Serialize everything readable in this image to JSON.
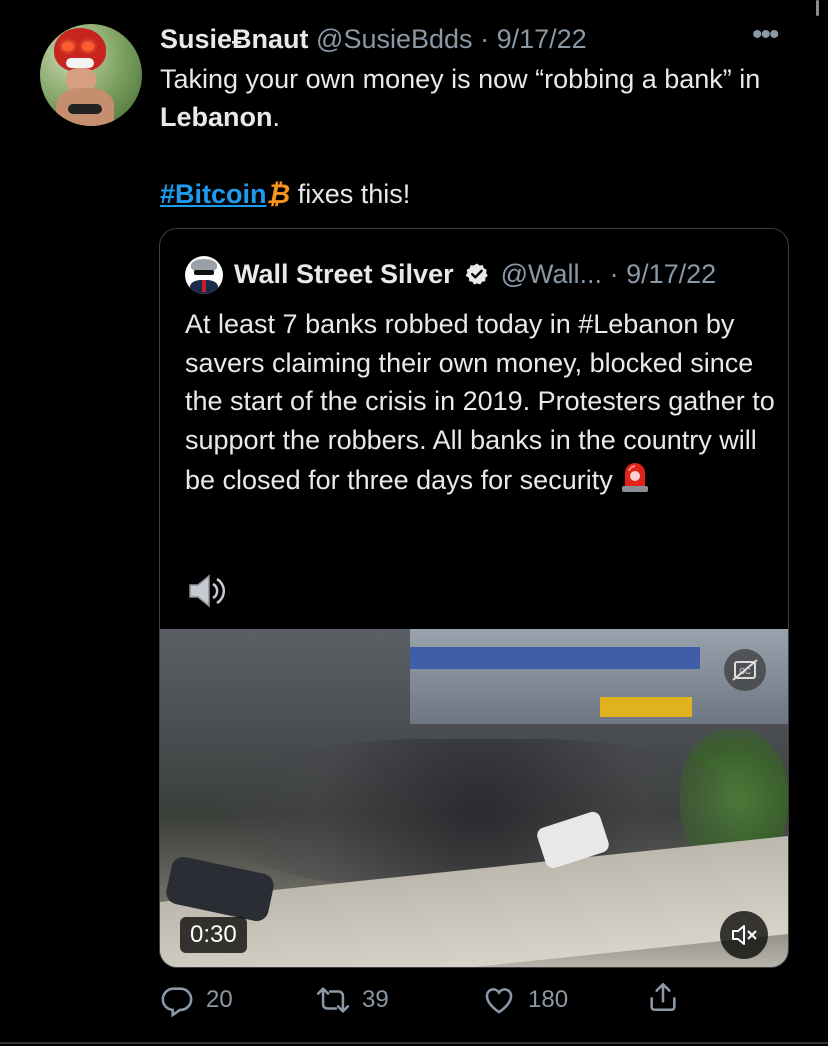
{
  "tweet": {
    "author_name": "SusieɃnaut",
    "author_handle": "@SusieBdds",
    "separator": "·",
    "date": "9/17/22",
    "more": "•••",
    "text_part1": "Taking your own money is now “robbing a bank” in ",
    "text_bold": "Lebanon",
    "text_part2": ".",
    "hashtag": "#Bitcoin",
    "btc_symbol": "₿",
    "text_end": " fixes this!"
  },
  "quote": {
    "author_name": "Wall Street Silver",
    "author_handle": "@Wall...",
    "separator": "·",
    "date": "9/17/22",
    "text": "At least 7 banks robbed today in #Lebanon by savers claiming their own money, blocked since the start of the crisis in 2019. Protesters gather to support the robbers. All banks in the country will be closed for three days for security"
  },
  "video": {
    "duration": "0:30",
    "cc_icon": "closed-captions-off-icon",
    "mute_icon": "muted-speaker-icon"
  },
  "actions": {
    "replies": "20",
    "retweets": "39",
    "likes": "180"
  },
  "colors": {
    "background": "#000000",
    "text": "#e7e9ea",
    "muted": "#8b98a5",
    "link": "#1d9bf0",
    "bitcoin": "#f7931a",
    "border": "#3a3d42"
  }
}
